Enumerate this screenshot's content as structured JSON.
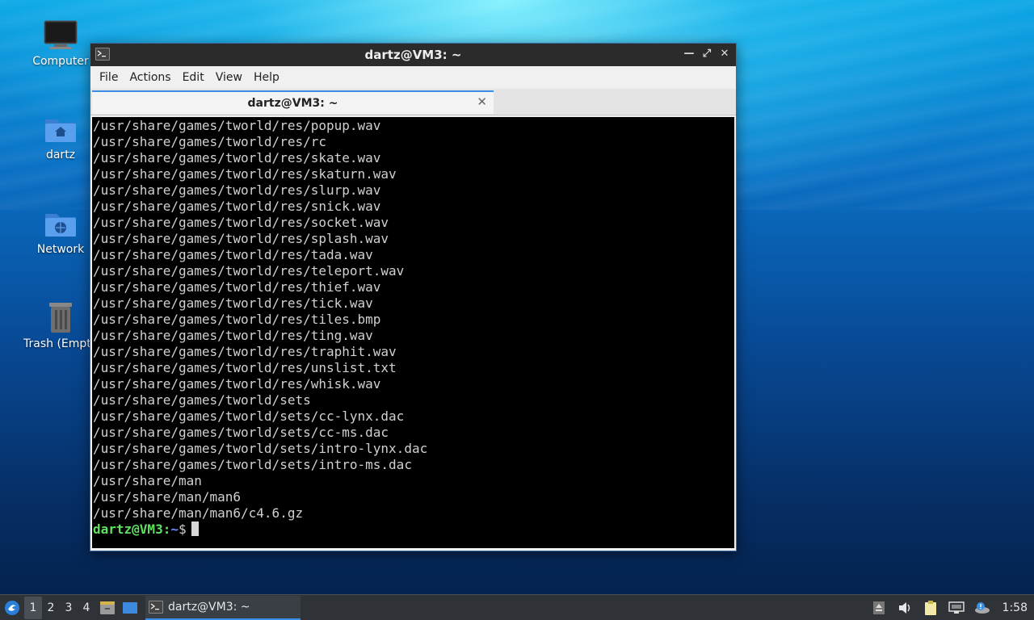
{
  "desktop": {
    "icons": [
      {
        "label": "Computer"
      },
      {
        "label": "dartz"
      },
      {
        "label": "Network"
      },
      {
        "label": "Trash (Empty)"
      }
    ]
  },
  "window": {
    "title": "dartz@VM3: ~",
    "menu": [
      "File",
      "Actions",
      "Edit",
      "View",
      "Help"
    ],
    "tab": {
      "label": "dartz@VM3: ~"
    },
    "terminal": {
      "lines": [
        "/usr/share/games/tworld/res/popup.wav",
        "/usr/share/games/tworld/res/rc",
        "/usr/share/games/tworld/res/skate.wav",
        "/usr/share/games/tworld/res/skaturn.wav",
        "/usr/share/games/tworld/res/slurp.wav",
        "/usr/share/games/tworld/res/snick.wav",
        "/usr/share/games/tworld/res/socket.wav",
        "/usr/share/games/tworld/res/splash.wav",
        "/usr/share/games/tworld/res/tada.wav",
        "/usr/share/games/tworld/res/teleport.wav",
        "/usr/share/games/tworld/res/thief.wav",
        "/usr/share/games/tworld/res/tick.wav",
        "/usr/share/games/tworld/res/tiles.bmp",
        "/usr/share/games/tworld/res/ting.wav",
        "/usr/share/games/tworld/res/traphit.wav",
        "/usr/share/games/tworld/res/unslist.txt",
        "/usr/share/games/tworld/res/whisk.wav",
        "/usr/share/games/tworld/sets",
        "/usr/share/games/tworld/sets/cc-lynx.dac",
        "/usr/share/games/tworld/sets/cc-ms.dac",
        "/usr/share/games/tworld/sets/intro-lynx.dac",
        "/usr/share/games/tworld/sets/intro-ms.dac",
        "/usr/share/man",
        "/usr/share/man/man6",
        "/usr/share/man/man6/c4.6.gz"
      ],
      "prompt": {
        "user_host": "dartz@VM3",
        "sep": ":",
        "path": "~",
        "symbol": "$"
      }
    }
  },
  "taskbar": {
    "workspaces": [
      "1",
      "2",
      "3",
      "4"
    ],
    "active_workspace": "1",
    "task_label": "dartz@VM3: ~",
    "clock": "1:58"
  },
  "colors": {
    "prompt_user": "#5fe05f",
    "prompt_path": "#6a8cff",
    "accent": "#3a8ee6",
    "terminal_bg": "#000000"
  }
}
